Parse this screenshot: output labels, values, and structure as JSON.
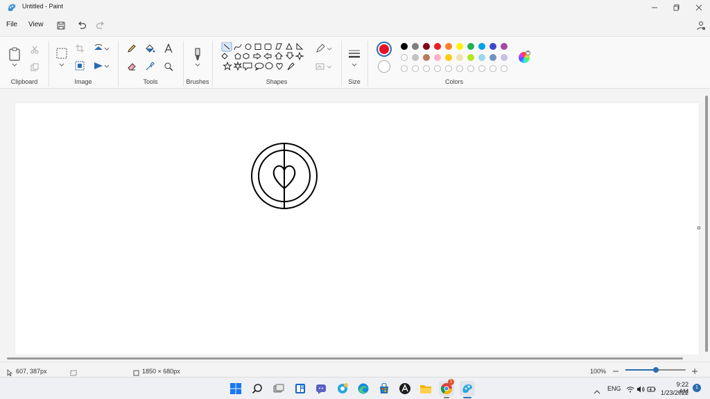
{
  "window": {
    "title": "Untitled - Paint"
  },
  "menu": {
    "file": "File",
    "view": "View"
  },
  "ribbon": {
    "groups": {
      "clipboard": "Clipboard",
      "image": "Image",
      "tools": "Tools",
      "brushes": "Brushes",
      "shapes": "Shapes",
      "size": "Size",
      "colors": "Colors"
    },
    "primary_color": "#e81123",
    "secondary_color": "#ffffff",
    "palette_row1": [
      "#000000",
      "#7f7f7f",
      "#880015",
      "#ed1c24",
      "#ff7f27",
      "#fff200",
      "#22b14c",
      "#00a2e8",
      "#3f48cc",
      "#a349a4"
    ],
    "palette_row2": [
      "#ffffff",
      "#c3c3c3",
      "#b97a57",
      "#ffaec9",
      "#ffc90e",
      "#efe4b0",
      "#b5e61d",
      "#99d9ea",
      "#7092be",
      "#c8bfe7"
    ]
  },
  "status": {
    "cursor_pos": "607, 387px",
    "canvas_size": "1850 × 680px",
    "zoom": "100%",
    "zoom_level": 0.5
  },
  "taskbar": {
    "lang": "ENG",
    "time": "9:22 AM",
    "date": "1/23/2022",
    "notif_count": "1"
  }
}
